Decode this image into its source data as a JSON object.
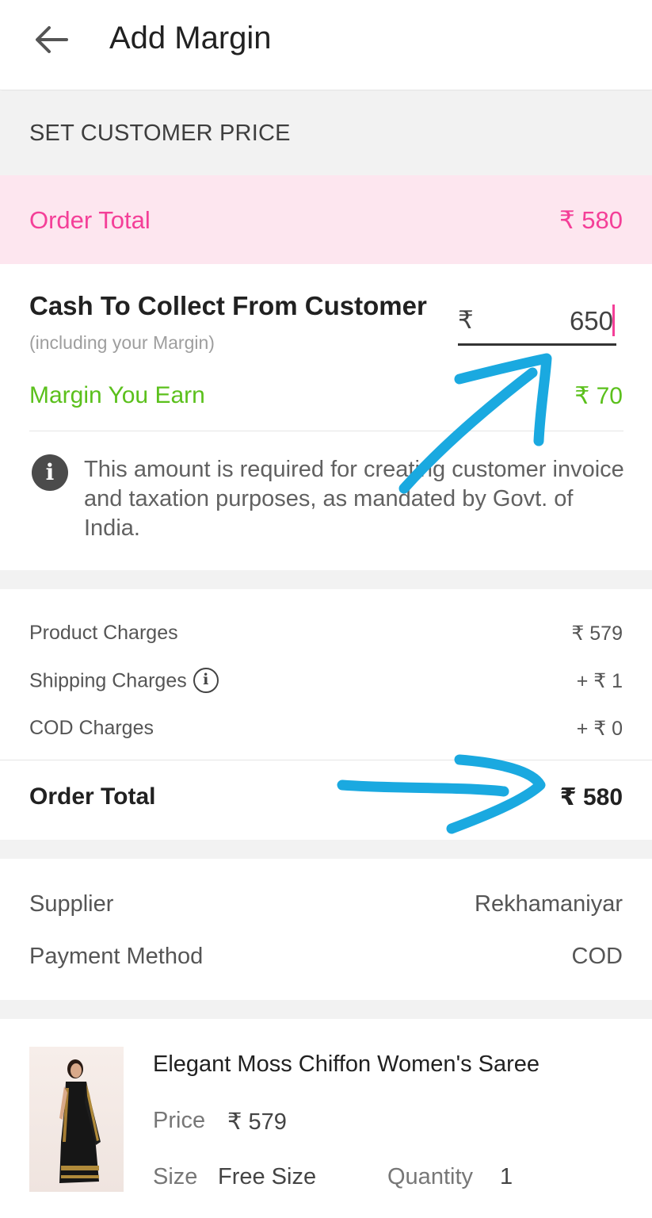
{
  "header": {
    "back_icon": "arrow-left-icon",
    "title": "Add Margin"
  },
  "section": {
    "title": "SET CUSTOMER PRICE"
  },
  "order_total_banner": {
    "label": "Order Total",
    "value": "₹ 580",
    "color": "#f43f98",
    "background": "#fde6ef"
  },
  "cash_collect": {
    "title": "Cash To Collect From Customer",
    "subtitle": "(including your Margin)",
    "currency_symbol": "₹",
    "input_value": "650"
  },
  "margin": {
    "label": "Margin You Earn",
    "value": "₹ 70",
    "color": "#5bc01c"
  },
  "notice": {
    "icon": "info-icon",
    "text": "This amount is required for creating customer invoice and taxation purposes, as mandated by Govt. of India."
  },
  "charges": {
    "rows": [
      {
        "label": "Product Charges",
        "value": "₹ 579"
      },
      {
        "label": "Shipping Charges",
        "value": "+ ₹ 1"
      },
      {
        "label": "COD Charges",
        "value": "+ ₹ 0"
      }
    ],
    "total_label": "Order Total",
    "total_value": "₹ 580"
  },
  "details": {
    "supplier_label": "Supplier",
    "supplier_value": "Rekhamaniyar",
    "payment_label": "Payment Method",
    "payment_value": "COD"
  },
  "product": {
    "name": "Elegant Moss Chiffon Women's Saree",
    "price_label": "Price",
    "price_value": "₹ 579",
    "size_label": "Size",
    "size_value": "Free Size",
    "quantity_label": "Quantity",
    "quantity_value": "1"
  },
  "annotation_color": "#1aa9e0"
}
